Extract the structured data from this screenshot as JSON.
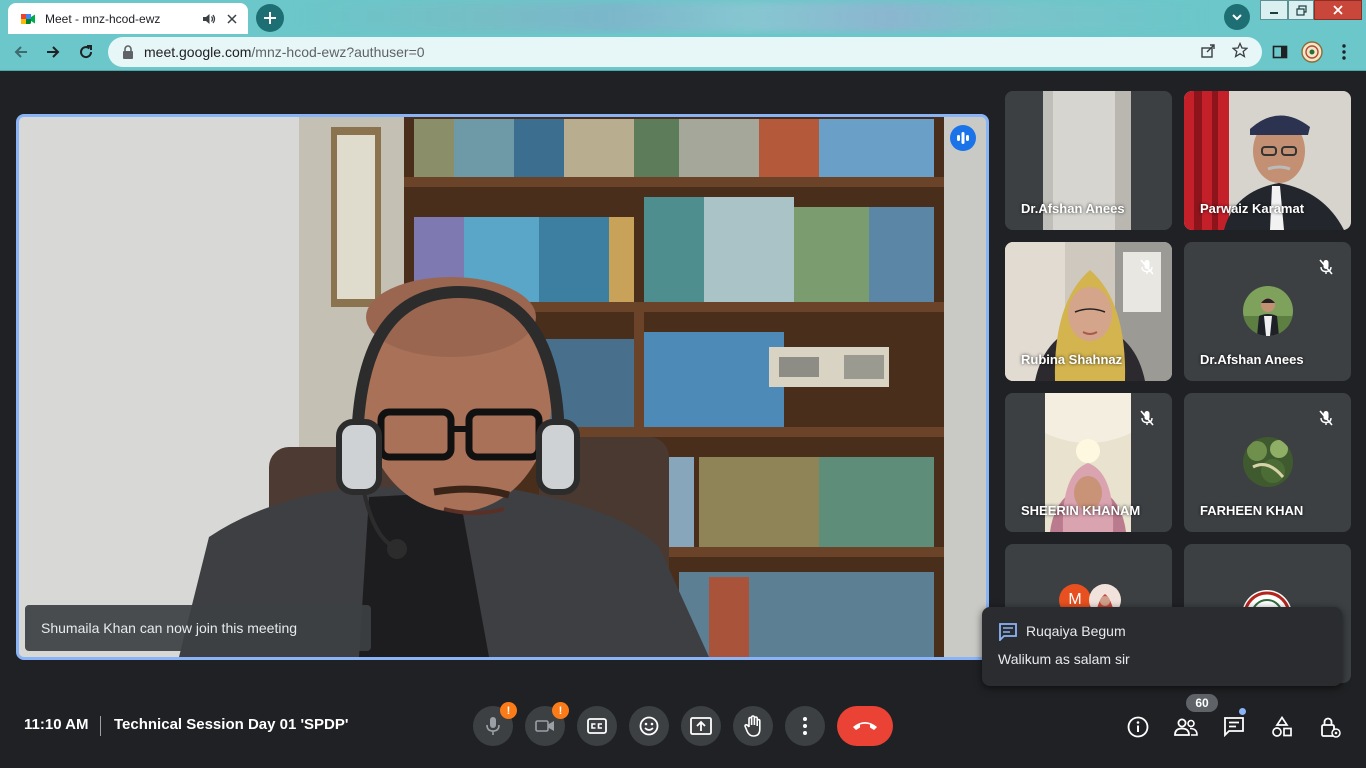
{
  "browser": {
    "tab_title": "Meet - mnz-hcod-ewz",
    "url_host": "meet.google.com",
    "url_path": "/mnz-hcod-ewz?authuser=0"
  },
  "main_tile": {
    "toast": "Shumaila Khan can now join this meeting"
  },
  "participants": [
    {
      "name": "Dr.Afshan Anees",
      "muted": false
    },
    {
      "name": "Parwaiz Karamat",
      "muted": false
    },
    {
      "name": "Rubina Shahnaz",
      "muted": true
    },
    {
      "name": "Dr.Afshan Anees",
      "muted": true
    },
    {
      "name": "SHEERIN KHANAM",
      "muted": true
    },
    {
      "name": "FARHEEN KHAN",
      "muted": true
    },
    {
      "avatar_letter": "M"
    }
  ],
  "chat": {
    "sender": "Ruqaiya Begum",
    "message": "Walikum as salam sir"
  },
  "meeting": {
    "time": "11:10 AM",
    "title": "Technical Session Day 01 'SPDP'"
  },
  "controls": {
    "warning_glyph": "!",
    "participant_count": "60"
  },
  "colors": {
    "accent_blue": "#8ab4f8",
    "end_call_red": "#ea4335",
    "warning_orange": "#fa7b17",
    "chrome_teal": "#6bc7c9"
  }
}
